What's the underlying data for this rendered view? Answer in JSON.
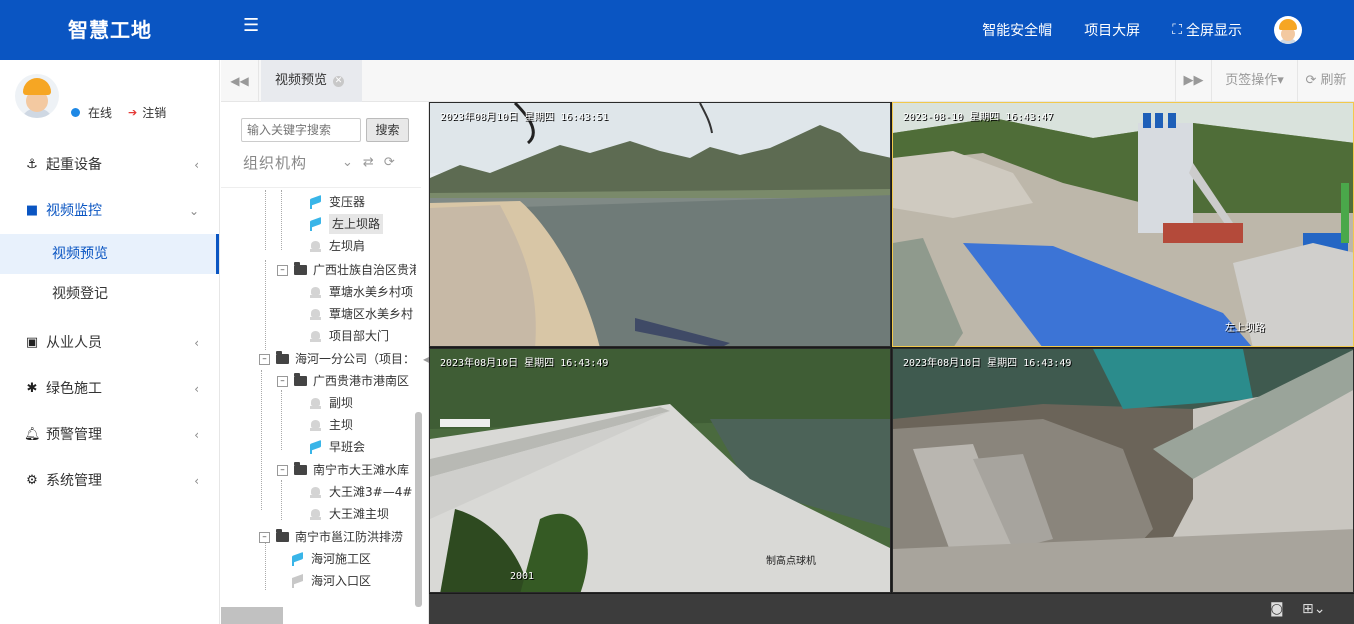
{
  "app": {
    "title": "智慧工地"
  },
  "header": {
    "nav": [
      "智能安全帽",
      "项目大屏",
      "全屏显示"
    ]
  },
  "user": {
    "status_online": "在线",
    "logout": "注销"
  },
  "sidebar": {
    "items": [
      {
        "label": "起重设备",
        "icon": "anchor-icon"
      },
      {
        "label": "视频监控",
        "icon": "video-camera-icon",
        "children": [
          "视频预览",
          "视频登记"
        ]
      },
      {
        "label": "从业人员",
        "icon": "id-card-icon"
      },
      {
        "label": "绿色施工",
        "icon": "asterisk-icon"
      },
      {
        "label": "预警管理",
        "icon": "bell-icon"
      },
      {
        "label": "系统管理",
        "icon": "gear-icon"
      }
    ]
  },
  "tabs": {
    "active": "视频预览",
    "ops": "页签操作",
    "refresh": "刷新"
  },
  "tree_panel": {
    "search_placeholder": "输入关键字搜索",
    "search_button": "搜索",
    "title": "组织机构",
    "nodes": [
      "变压器",
      "左上坝路",
      "左坝肩",
      "广西壮族自治区贵港",
      "覃塘水美乡村项",
      "覃塘区水美乡村",
      "项目部大门",
      "海河一分公司（项目：",
      "广西贵港市港南区",
      "副坝",
      "主坝",
      "早班会",
      "南宁市大王滩水库",
      "大王滩3#—4#",
      "大王滩主坝",
      "南宁市邕江防洪排涝",
      "海河施工区",
      "海河入口区"
    ]
  },
  "videos": [
    {
      "osd": "2023年08月10日  星期四  16:43:51"
    },
    {
      "osd": "2023-08-10  星期四  16:43:47",
      "label": "左上坝路"
    },
    {
      "osd": "2023年08月10日  星期四  16:43:49",
      "label": "制高点球机",
      "label2": "2001"
    },
    {
      "osd": "2023年08月10日  星期四  16:43:49"
    }
  ],
  "colors": {
    "brand": "#0a55c2",
    "selected_border": "#f2c94c"
  }
}
